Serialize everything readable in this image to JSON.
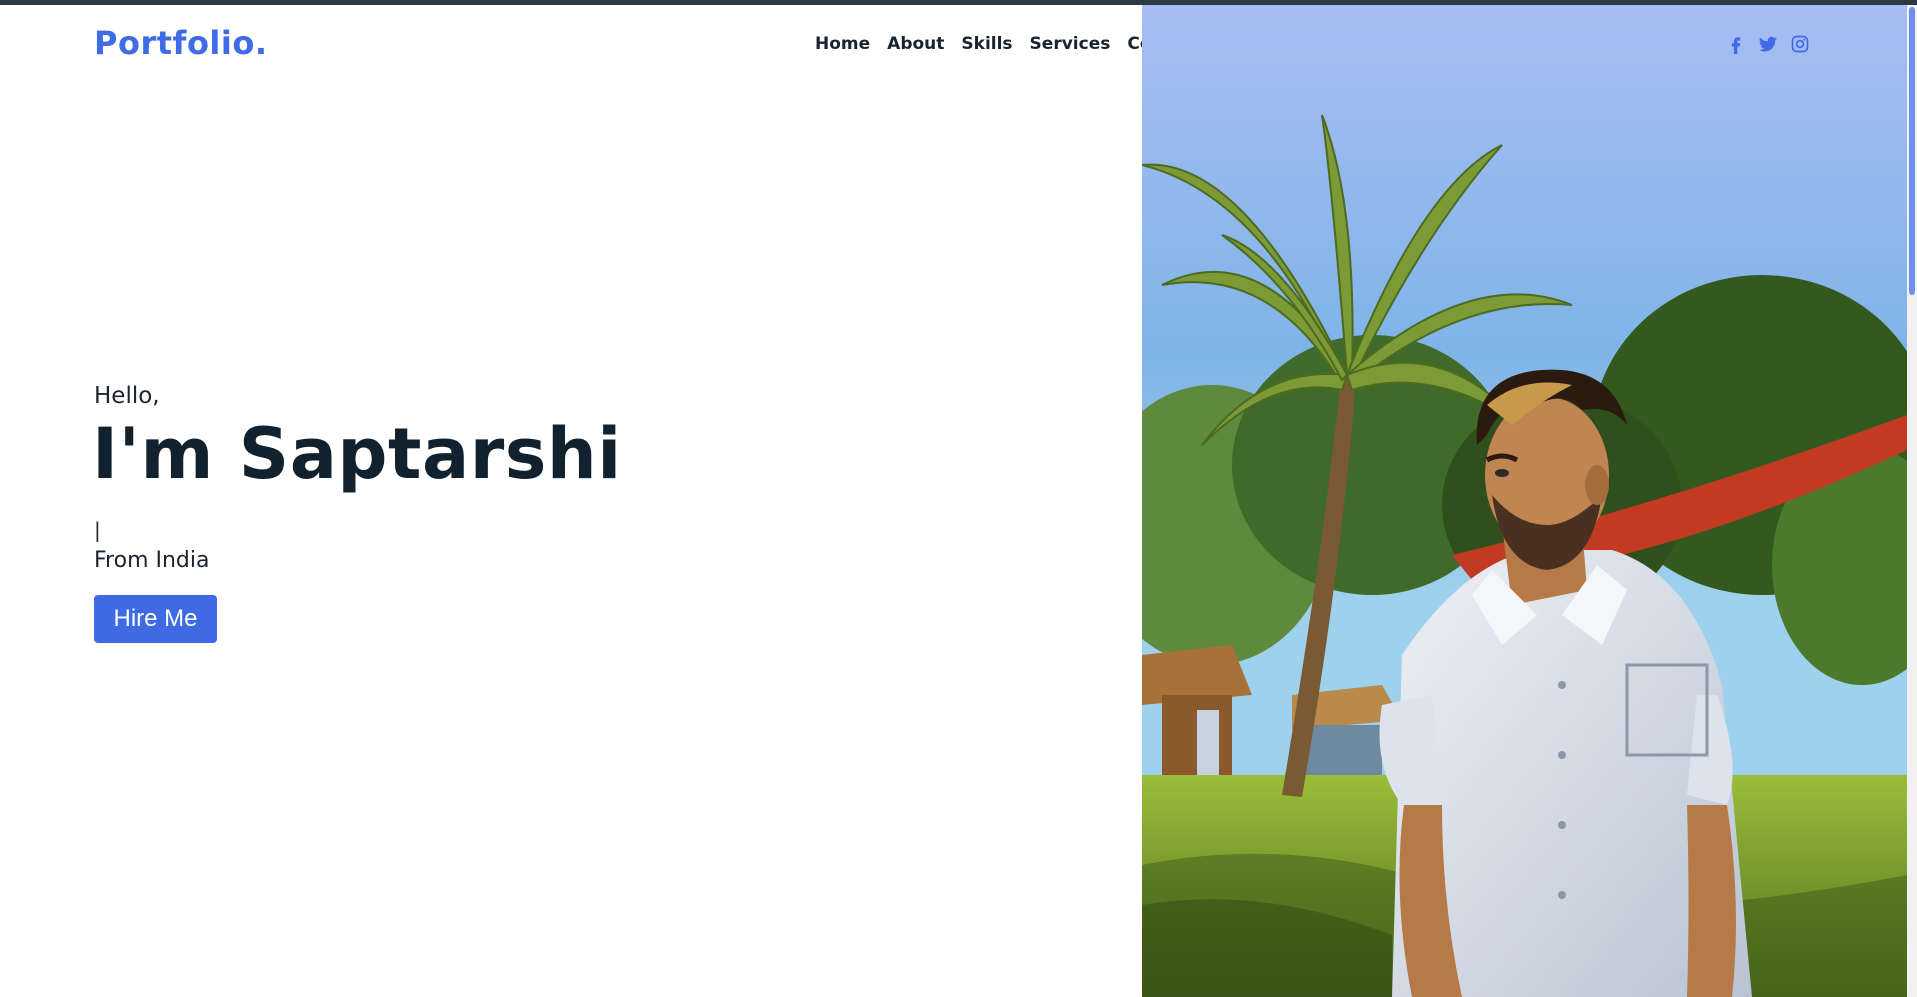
{
  "brand": {
    "logo_text": "Portfolio."
  },
  "nav": {
    "items": [
      "Home",
      "About",
      "Skills",
      "Services",
      "Contact"
    ]
  },
  "socials": [
    {
      "name": "facebook-icon"
    },
    {
      "name": "twitter-icon"
    },
    {
      "name": "instagram-icon"
    }
  ],
  "hero": {
    "greeting": "Hello,",
    "headline": "I'm Saptarshi",
    "typing_caret": "|",
    "location": "From India",
    "cta_label": "Hire Me"
  },
  "colors": {
    "accent": "#3e6ae3",
    "text_dark": "#12212e",
    "top_strip": "#2b3a42"
  }
}
